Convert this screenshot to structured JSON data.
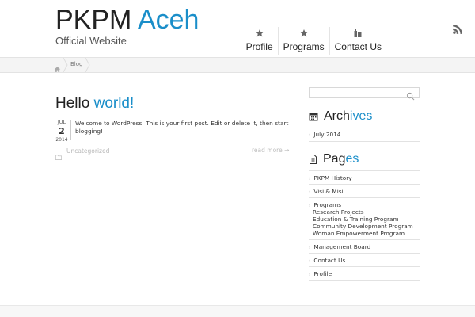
{
  "header": {
    "title_main": "PKPM",
    "title_accent": "Aceh",
    "tagline": "Official Website"
  },
  "nav": {
    "items": [
      {
        "label": "Profile",
        "icon": "star-icon"
      },
      {
        "label": "Programs",
        "icon": "star-icon"
      },
      {
        "label": "Contact Us",
        "icon": "building-icon"
      }
    ]
  },
  "breadcrumb": {
    "items": [
      "Blog"
    ]
  },
  "post": {
    "title_main": "Hello",
    "title_accent": "world!",
    "date": {
      "month": "JUL",
      "day": "2",
      "year": "2014"
    },
    "excerpt": "Welcome to WordPress. This is your first post. Edit or delete it, then start blogging!",
    "category": "Uncategorized",
    "read_more": "read more →"
  },
  "sidebar": {
    "search_placeholder": "",
    "archives": {
      "title_main": "Arch",
      "title_accent": "ives",
      "items": [
        "July 2014"
      ]
    },
    "pages": {
      "title_main": "Pag",
      "title_accent": "es",
      "items": [
        "PKPM History",
        "Visi & Misi",
        "Programs"
      ],
      "programs_children": [
        "Research Projects",
        "Education & Training Program",
        "Community Development Program",
        "Woman Empowerment Program"
      ],
      "items_after": [
        "Management Board",
        "Contact Us",
        "Profile"
      ]
    }
  },
  "colors": {
    "accent": "#1a8ec9",
    "text": "#222222"
  }
}
